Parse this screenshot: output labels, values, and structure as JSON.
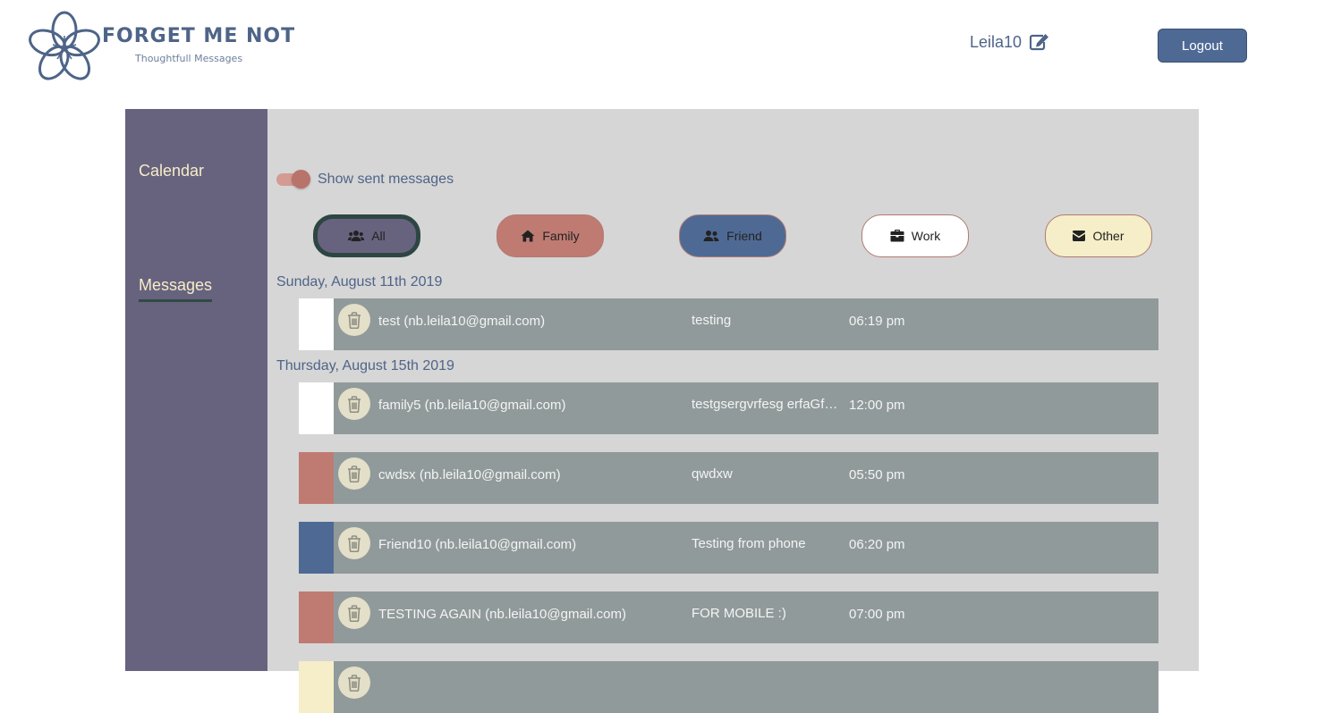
{
  "brand": {
    "title": "FORGET ME NOT",
    "subtitle": "Thoughtfull Messages"
  },
  "user": {
    "name": "Leila10",
    "logout_label": "Logout"
  },
  "sidebar": {
    "items": [
      {
        "label": "Calendar"
      },
      {
        "label": "Messages"
      }
    ]
  },
  "toggle": {
    "label": "Show sent messages",
    "on": true
  },
  "filters": [
    {
      "label": "All",
      "icon": "users-icon",
      "color": "#67637e"
    },
    {
      "label": "Family",
      "icon": "home-icon",
      "color": "#bf7b72"
    },
    {
      "label": "Friend",
      "icon": "user-friends-icon",
      "color": "#4e6a94"
    },
    {
      "label": "Work",
      "icon": "briefcase-icon",
      "color": "#ffffff"
    },
    {
      "label": "Other",
      "icon": "envelope-icon",
      "color": "#f5eec8"
    }
  ],
  "groups": [
    {
      "date": "Sunday, August 11th 2019",
      "messages": [
        {
          "recipient": "test (nb.leila10@gmail.com)",
          "text": "testing",
          "time": "06:19 pm",
          "category_color": "#ffffff"
        }
      ]
    },
    {
      "date": "Thursday, August 15th 2019",
      "messages": [
        {
          "recipient": "family5 (nb.leila10@gmail.com)",
          "text": "testgsergvrfesg erfaGfgerf",
          "time": "12:00 pm",
          "category_color": "#ffffff"
        },
        {
          "recipient": "cwdsx (nb.leila10@gmail.com)",
          "text": "qwdxw",
          "time": "05:50 pm",
          "category_color": "#bf7b72"
        },
        {
          "recipient": "Friend10 (nb.leila10@gmail.com)",
          "text": "Testing from phone",
          "time": "06:20 pm",
          "category_color": "#4e6a94"
        },
        {
          "recipient": "TESTING AGAIN (nb.leila10@gmail.com)",
          "text": "FOR MOBILE :)",
          "time": "07:00 pm",
          "category_color": "#bf7b72"
        },
        {
          "recipient": "",
          "text": "",
          "time": "",
          "category_color": "#f5eec8"
        }
      ]
    }
  ]
}
